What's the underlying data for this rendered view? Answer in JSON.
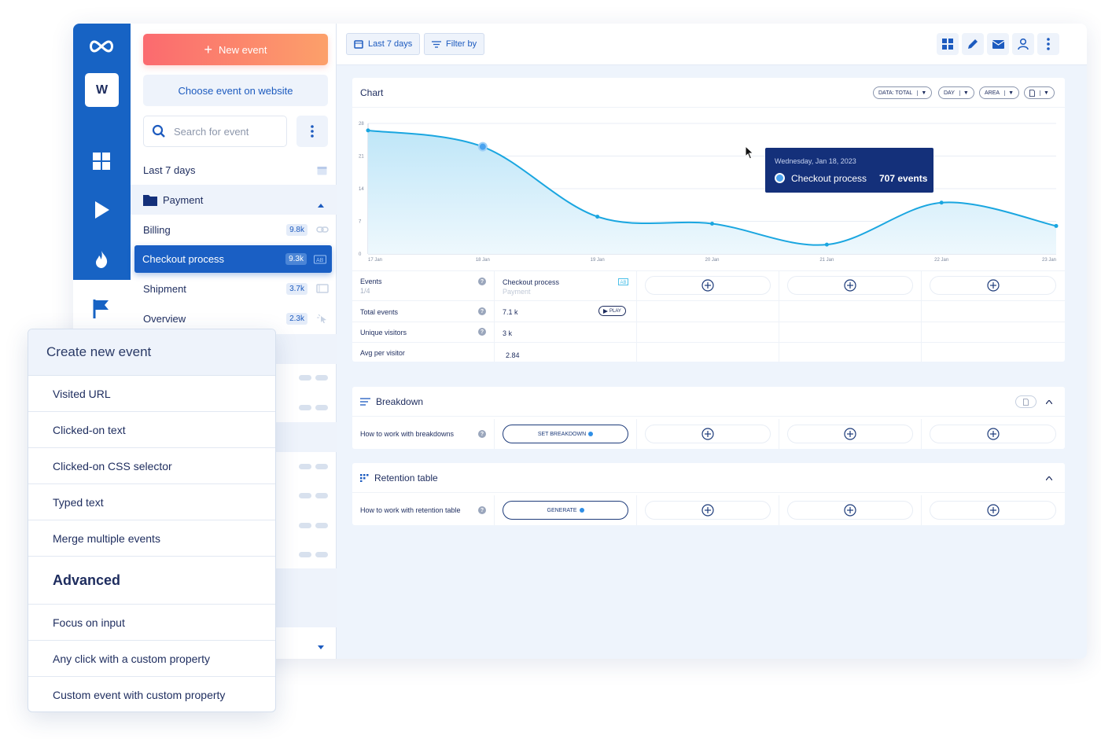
{
  "rail": {
    "workspace_letter": "W"
  },
  "panel": {
    "new_event_label": "New event",
    "choose_event_label": "Choose event on website",
    "search_placeholder": "Search for event",
    "date_range": "Last 7 days",
    "folder": "Payment",
    "events": [
      {
        "label": "Billing",
        "count": "9.8k"
      },
      {
        "label": "Checkout process",
        "count": "9.3k"
      },
      {
        "label": "Shipment",
        "count": "3.7k"
      },
      {
        "label": "Overview",
        "count": "2.3k"
      }
    ]
  },
  "toolbar": {
    "date_label": "Last 7 days",
    "filter_label": "Filter by"
  },
  "chart_card": {
    "title": "Chart",
    "data_dd": "DATA: TOTAL",
    "day_dd": "DAY",
    "area_dd": "AREA"
  },
  "chart_data": {
    "type": "area",
    "categories": [
      "17 Jan",
      "18 Jan",
      "19 Jan",
      "20 Jan",
      "21 Jan",
      "22 Jan",
      "23 Jan"
    ],
    "series": [
      {
        "values": [
          26.5,
          23,
          8,
          6.5,
          2,
          11,
          6
        ]
      }
    ],
    "ylim": [
      0,
      28
    ],
    "yticks": [
      "28",
      "21",
      "14",
      "7",
      "0"
    ],
    "grid": true
  },
  "tooltip": {
    "date": "Wednesday, Jan 18, 2023",
    "event": "Checkout process",
    "value": "707 events"
  },
  "metrics": {
    "events_label": "Events",
    "events_sub": "1/4",
    "event_name": "Checkout process",
    "event_folder": "Payment",
    "total_label": "Total events",
    "total_value": "7.1 k",
    "play_label": "PLAY",
    "unique_label": "Unique visitors",
    "unique_value": "3 k",
    "avg_label": "Avg per visitor",
    "avg_value": "2.84"
  },
  "breakdown": {
    "title": "Breakdown",
    "row_label": "How to work with breakdowns",
    "button": "SET BREAKDOWN"
  },
  "retention": {
    "title": "Retention table",
    "row_label": "How to work with retention table",
    "button": "GENERATE"
  },
  "popup": {
    "title": "Create new event",
    "items": [
      "Visited URL",
      "Clicked-on text",
      "Clicked-on CSS selector",
      "Typed text",
      "Merge multiple events"
    ],
    "advanced_label": "Advanced",
    "advanced_items": [
      "Focus on input",
      "Any click with a custom property",
      "Custom event with custom property"
    ]
  },
  "colors": {
    "primary": "#1a5fc4",
    "rail": "#1763c4",
    "accent_gradient_start": "#fb6a6f",
    "accent_gradient_end": "#fca06a",
    "line": "#1aa6e0",
    "tooltip": "#14307a"
  }
}
